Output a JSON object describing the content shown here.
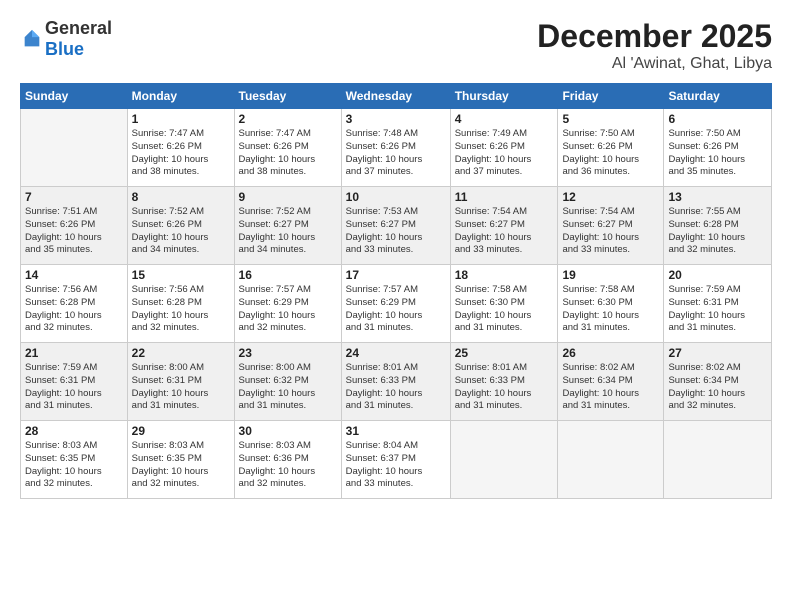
{
  "header": {
    "logo_general": "General",
    "logo_blue": "Blue",
    "title": "December 2025",
    "location": "Al 'Awinat, Ghat, Libya"
  },
  "weekdays": [
    "Sunday",
    "Monday",
    "Tuesday",
    "Wednesday",
    "Thursday",
    "Friday",
    "Saturday"
  ],
  "weeks": [
    [
      {
        "num": "",
        "info": ""
      },
      {
        "num": "1",
        "info": "Sunrise: 7:47 AM\nSunset: 6:26 PM\nDaylight: 10 hours\nand 38 minutes."
      },
      {
        "num": "2",
        "info": "Sunrise: 7:47 AM\nSunset: 6:26 PM\nDaylight: 10 hours\nand 38 minutes."
      },
      {
        "num": "3",
        "info": "Sunrise: 7:48 AM\nSunset: 6:26 PM\nDaylight: 10 hours\nand 37 minutes."
      },
      {
        "num": "4",
        "info": "Sunrise: 7:49 AM\nSunset: 6:26 PM\nDaylight: 10 hours\nand 37 minutes."
      },
      {
        "num": "5",
        "info": "Sunrise: 7:50 AM\nSunset: 6:26 PM\nDaylight: 10 hours\nand 36 minutes."
      },
      {
        "num": "6",
        "info": "Sunrise: 7:50 AM\nSunset: 6:26 PM\nDaylight: 10 hours\nand 35 minutes."
      }
    ],
    [
      {
        "num": "7",
        "info": "Sunrise: 7:51 AM\nSunset: 6:26 PM\nDaylight: 10 hours\nand 35 minutes."
      },
      {
        "num": "8",
        "info": "Sunrise: 7:52 AM\nSunset: 6:26 PM\nDaylight: 10 hours\nand 34 minutes."
      },
      {
        "num": "9",
        "info": "Sunrise: 7:52 AM\nSunset: 6:27 PM\nDaylight: 10 hours\nand 34 minutes."
      },
      {
        "num": "10",
        "info": "Sunrise: 7:53 AM\nSunset: 6:27 PM\nDaylight: 10 hours\nand 33 minutes."
      },
      {
        "num": "11",
        "info": "Sunrise: 7:54 AM\nSunset: 6:27 PM\nDaylight: 10 hours\nand 33 minutes."
      },
      {
        "num": "12",
        "info": "Sunrise: 7:54 AM\nSunset: 6:27 PM\nDaylight: 10 hours\nand 33 minutes."
      },
      {
        "num": "13",
        "info": "Sunrise: 7:55 AM\nSunset: 6:28 PM\nDaylight: 10 hours\nand 32 minutes."
      }
    ],
    [
      {
        "num": "14",
        "info": "Sunrise: 7:56 AM\nSunset: 6:28 PM\nDaylight: 10 hours\nand 32 minutes."
      },
      {
        "num": "15",
        "info": "Sunrise: 7:56 AM\nSunset: 6:28 PM\nDaylight: 10 hours\nand 32 minutes."
      },
      {
        "num": "16",
        "info": "Sunrise: 7:57 AM\nSunset: 6:29 PM\nDaylight: 10 hours\nand 32 minutes."
      },
      {
        "num": "17",
        "info": "Sunrise: 7:57 AM\nSunset: 6:29 PM\nDaylight: 10 hours\nand 31 minutes."
      },
      {
        "num": "18",
        "info": "Sunrise: 7:58 AM\nSunset: 6:30 PM\nDaylight: 10 hours\nand 31 minutes."
      },
      {
        "num": "19",
        "info": "Sunrise: 7:58 AM\nSunset: 6:30 PM\nDaylight: 10 hours\nand 31 minutes."
      },
      {
        "num": "20",
        "info": "Sunrise: 7:59 AM\nSunset: 6:31 PM\nDaylight: 10 hours\nand 31 minutes."
      }
    ],
    [
      {
        "num": "21",
        "info": "Sunrise: 7:59 AM\nSunset: 6:31 PM\nDaylight: 10 hours\nand 31 minutes."
      },
      {
        "num": "22",
        "info": "Sunrise: 8:00 AM\nSunset: 6:31 PM\nDaylight: 10 hours\nand 31 minutes."
      },
      {
        "num": "23",
        "info": "Sunrise: 8:00 AM\nSunset: 6:32 PM\nDaylight: 10 hours\nand 31 minutes."
      },
      {
        "num": "24",
        "info": "Sunrise: 8:01 AM\nSunset: 6:33 PM\nDaylight: 10 hours\nand 31 minutes."
      },
      {
        "num": "25",
        "info": "Sunrise: 8:01 AM\nSunset: 6:33 PM\nDaylight: 10 hours\nand 31 minutes."
      },
      {
        "num": "26",
        "info": "Sunrise: 8:02 AM\nSunset: 6:34 PM\nDaylight: 10 hours\nand 31 minutes."
      },
      {
        "num": "27",
        "info": "Sunrise: 8:02 AM\nSunset: 6:34 PM\nDaylight: 10 hours\nand 32 minutes."
      }
    ],
    [
      {
        "num": "28",
        "info": "Sunrise: 8:03 AM\nSunset: 6:35 PM\nDaylight: 10 hours\nand 32 minutes."
      },
      {
        "num": "29",
        "info": "Sunrise: 8:03 AM\nSunset: 6:35 PM\nDaylight: 10 hours\nand 32 minutes."
      },
      {
        "num": "30",
        "info": "Sunrise: 8:03 AM\nSunset: 6:36 PM\nDaylight: 10 hours\nand 32 minutes."
      },
      {
        "num": "31",
        "info": "Sunrise: 8:04 AM\nSunset: 6:37 PM\nDaylight: 10 hours\nand 33 minutes."
      },
      {
        "num": "",
        "info": ""
      },
      {
        "num": "",
        "info": ""
      },
      {
        "num": "",
        "info": ""
      }
    ]
  ]
}
